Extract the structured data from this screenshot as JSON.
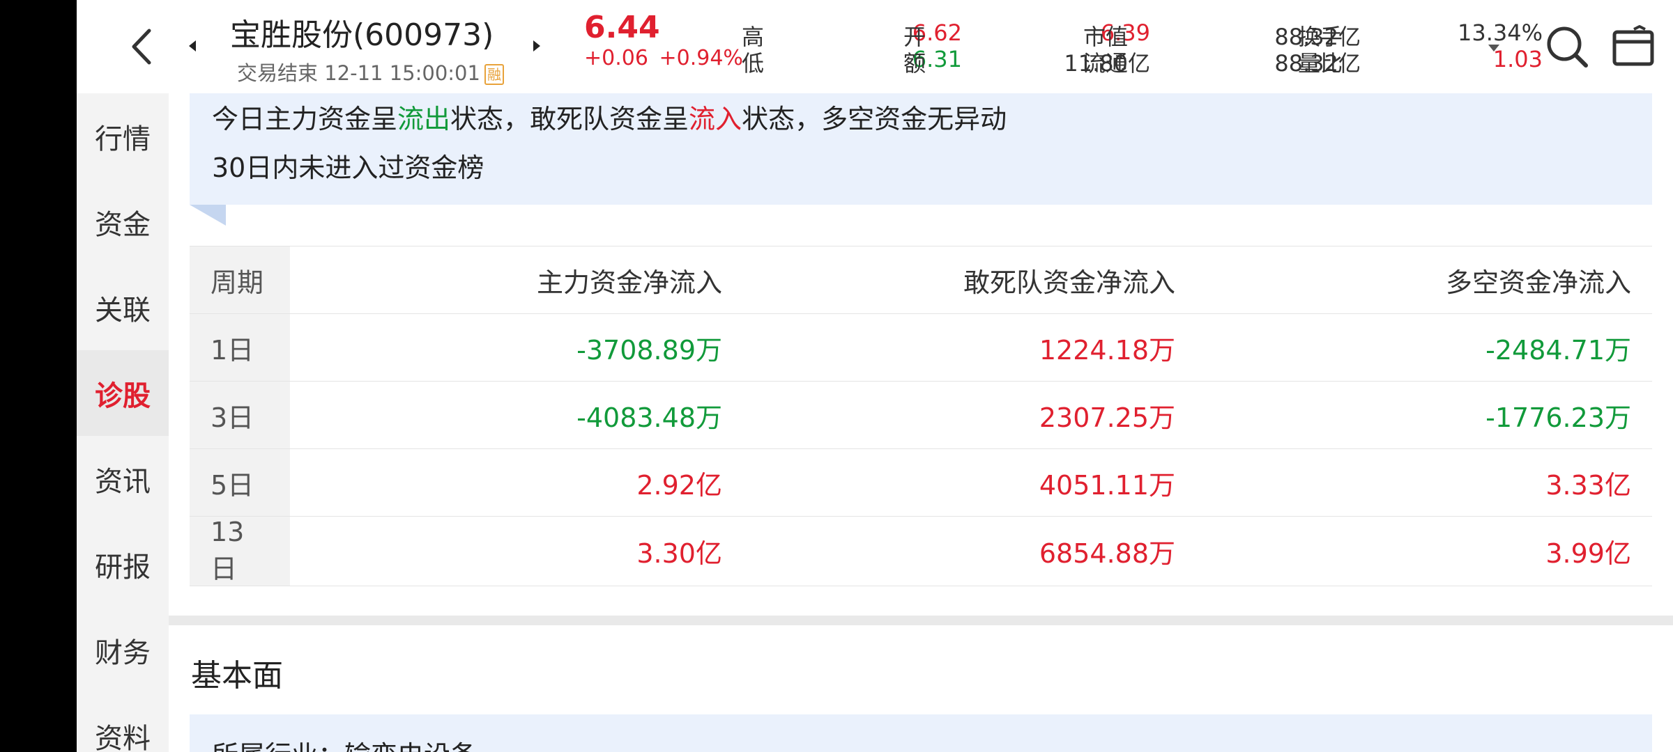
{
  "header": {
    "stock_name": "宝胜股份(600973)",
    "status": "交易结束 12-11 15:00:01",
    "rong_badge": "融",
    "price": "6.44",
    "change": "+0.06  +0.94%",
    "quotes": {
      "high_label": "高",
      "high_value": "6.62",
      "open_label": "开",
      "open_value": "6.39",
      "market_cap_label": "市值",
      "market_cap_value": "88.32亿",
      "turnover_label": "换手",
      "turnover_value": "13.34%",
      "low_label": "低",
      "low_value": "6.31",
      "amount_label": "额",
      "amount_value": "11.80亿",
      "float_cap_label": "流通",
      "float_cap_value": "88.32亿",
      "volume_ratio_label": "量比",
      "volume_ratio_value": "1.03"
    }
  },
  "sidebar": {
    "items": [
      {
        "label": "行情",
        "active": false
      },
      {
        "label": "资金",
        "active": false
      },
      {
        "label": "关联",
        "active": false
      },
      {
        "label": "诊股",
        "active": true
      },
      {
        "label": "资讯",
        "active": false
      },
      {
        "label": "研报",
        "active": false
      },
      {
        "label": "财务",
        "active": false
      },
      {
        "label": "资料",
        "active": false
      }
    ]
  },
  "summary": {
    "line1_part1": "今日主力资金呈",
    "line1_outflow": "流出",
    "line1_part2": "状态，敢死队资金呈",
    "line1_inflow": "流入",
    "line1_part3": "状态，多空资金无异动",
    "line2": "30日内未进入过资金榜"
  },
  "flow_table": {
    "headers": [
      "周期",
      "主力资金净流入",
      "敢死队资金净流入",
      "多空资金净流入"
    ],
    "rows": [
      {
        "period": "1日",
        "main": "-3708.89万",
        "dare": "1224.18万",
        "longshort": "-2484.71万"
      },
      {
        "period": "3日",
        "main": "-4083.48万",
        "dare": "2307.25万",
        "longshort": "-1776.23万"
      },
      {
        "period": "5日",
        "main": "2.92亿",
        "dare": "4051.11万",
        "longshort": "3.33亿"
      },
      {
        "period": "13日",
        "main": "3.30亿",
        "dare": "6854.88万",
        "longshort": "3.99亿"
      }
    ]
  },
  "fundamentals": {
    "title": "基本面",
    "industry": "所属行业：输变电设备"
  },
  "colors": {
    "up": "#e0202f",
    "down": "#119a3a"
  },
  "icons": {
    "back": "chevron-left-icon",
    "search": "search-icon",
    "share": "share-icon"
  }
}
